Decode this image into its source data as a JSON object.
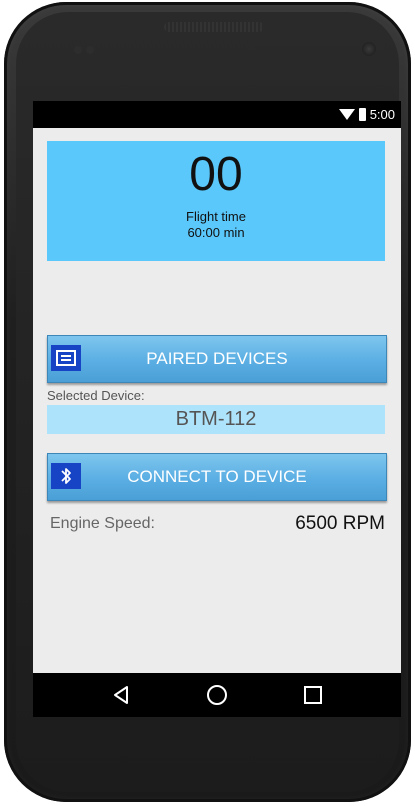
{
  "status_bar": {
    "time": "5:00"
  },
  "flight": {
    "value": "00",
    "label": "Flight time",
    "duration": "60:00 min"
  },
  "paired_devices": {
    "label": "PAIRED DEVICES",
    "icon": "list-icon"
  },
  "selected_device": {
    "label": "Selected Device:",
    "value": "BTM-112"
  },
  "connect": {
    "label": "CONNECT TO DEVICE",
    "icon": "bluetooth-icon"
  },
  "engine": {
    "label": "Engine Speed:",
    "value": "6500 RPM"
  },
  "nav": {
    "back_icon": "back-icon",
    "home_icon": "home-icon",
    "recents_icon": "recents-icon"
  },
  "colors": {
    "flight_panel": "#5ac8fa",
    "button": "#5aaee3",
    "button_icon_bg": "#1744c5",
    "selected_bg": "#aee4fb"
  }
}
